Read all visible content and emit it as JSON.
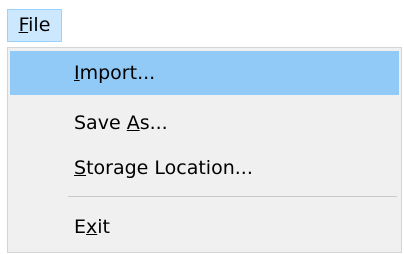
{
  "menubar": {
    "file": {
      "mnemonic": "F",
      "rest": "ile"
    }
  },
  "file_menu": {
    "items": [
      {
        "before": "",
        "mnemonic": "I",
        "after": "mport...",
        "highlighted": true
      },
      {
        "before": "Save ",
        "mnemonic": "A",
        "after": "s...",
        "highlighted": false
      },
      {
        "before": "",
        "mnemonic": "S",
        "after": "torage Location...",
        "highlighted": false
      },
      {
        "before": "E",
        "mnemonic": "x",
        "after": "it",
        "highlighted": false
      }
    ]
  },
  "colors": {
    "highlight": "#91c9f7",
    "menu_background": "#f0f0f0",
    "menubar_item_active": "#cce8ff"
  }
}
